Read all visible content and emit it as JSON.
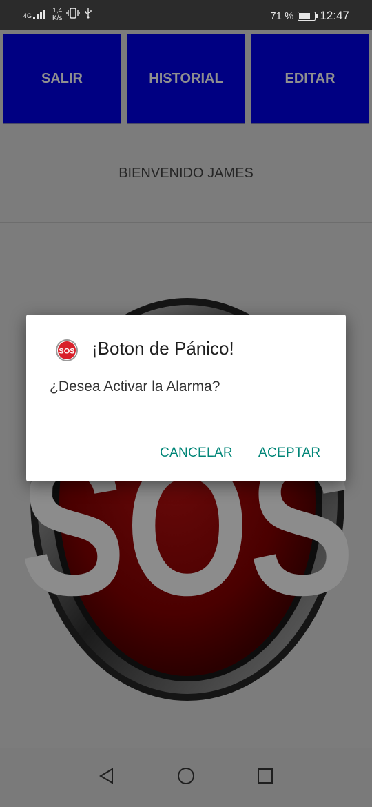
{
  "status_bar": {
    "network_type": "4G",
    "speed_value": "1,4",
    "speed_unit": "K/s",
    "battery_percent_text": "71 %",
    "battery_level": 0.71,
    "time": "12:47",
    "icons": [
      "signal-icon",
      "vibrate-icon",
      "usb-icon",
      "battery-icon"
    ]
  },
  "top_buttons": {
    "salir": "SALIR",
    "historial": "HISTORIAL",
    "editar": "EDITAR"
  },
  "welcome_text": "BIENVENIDO JAMES",
  "sos_graphic": {
    "label": "SOS"
  },
  "dialog": {
    "icon_text": "SOS",
    "title": "¡Boton de Pánico!",
    "message": "¿Desea Activar la Alarma?",
    "cancel_label": "CANCELAR",
    "accept_label": "ACEPTAR"
  },
  "nav_bar": {
    "icons": [
      "back-icon",
      "home-icon",
      "recents-icon"
    ]
  },
  "colors": {
    "top_button_bg": "#0000cc",
    "dialog_button_text": "#008577",
    "status_bar_bg": "#2b2b2b"
  }
}
